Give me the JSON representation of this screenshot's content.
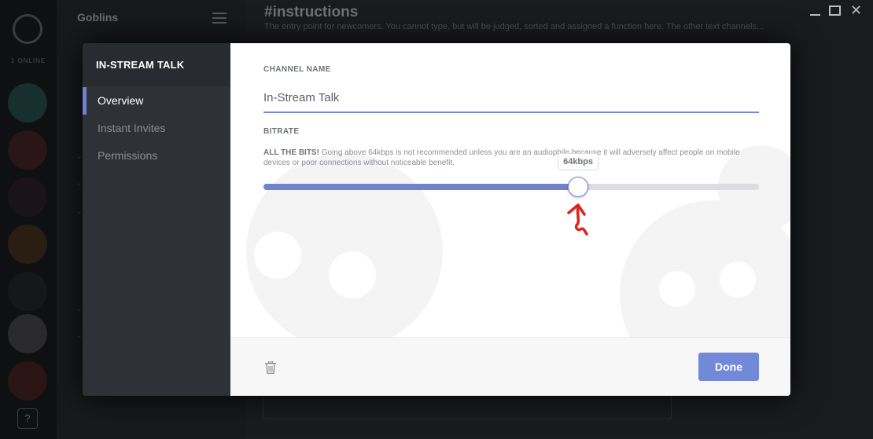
{
  "background": {
    "server_name": "Goblins",
    "online_label": "1 ONLINE",
    "chat_title": "#instructions",
    "chat_topic": "The entry point for newcomers. You cannot type, but will be judged, sorted and assigned a function here. The other text channels...",
    "help_label": "?"
  },
  "modal": {
    "sidebar_title": "IN-STREAM TALK",
    "nav": [
      {
        "label": "Overview",
        "active": true
      },
      {
        "label": "Instant Invites",
        "active": false
      },
      {
        "label": "Permissions",
        "active": false
      }
    ],
    "channel_name_label": "CHANNEL NAME",
    "channel_name_value": "In-Stream Talk",
    "bitrate_label": "BITRATE",
    "bitrate_desc_bold": "ALL THE BITS!",
    "bitrate_desc": "Going above 64kbps is not recommended unless you are an audiophile because it will adversely affect people on mobile devices or poor connections without noticeable benefit.",
    "bitrate_value": "64kbps",
    "bitrate_fraction": 0.635,
    "done_label": "Done"
  },
  "colors": {
    "accent": "#7289da",
    "annotation": "#e0201b",
    "sidebar": "#2e3136"
  },
  "icons": {
    "trash": "trash-icon",
    "annotation": "red-arrow-icon"
  }
}
